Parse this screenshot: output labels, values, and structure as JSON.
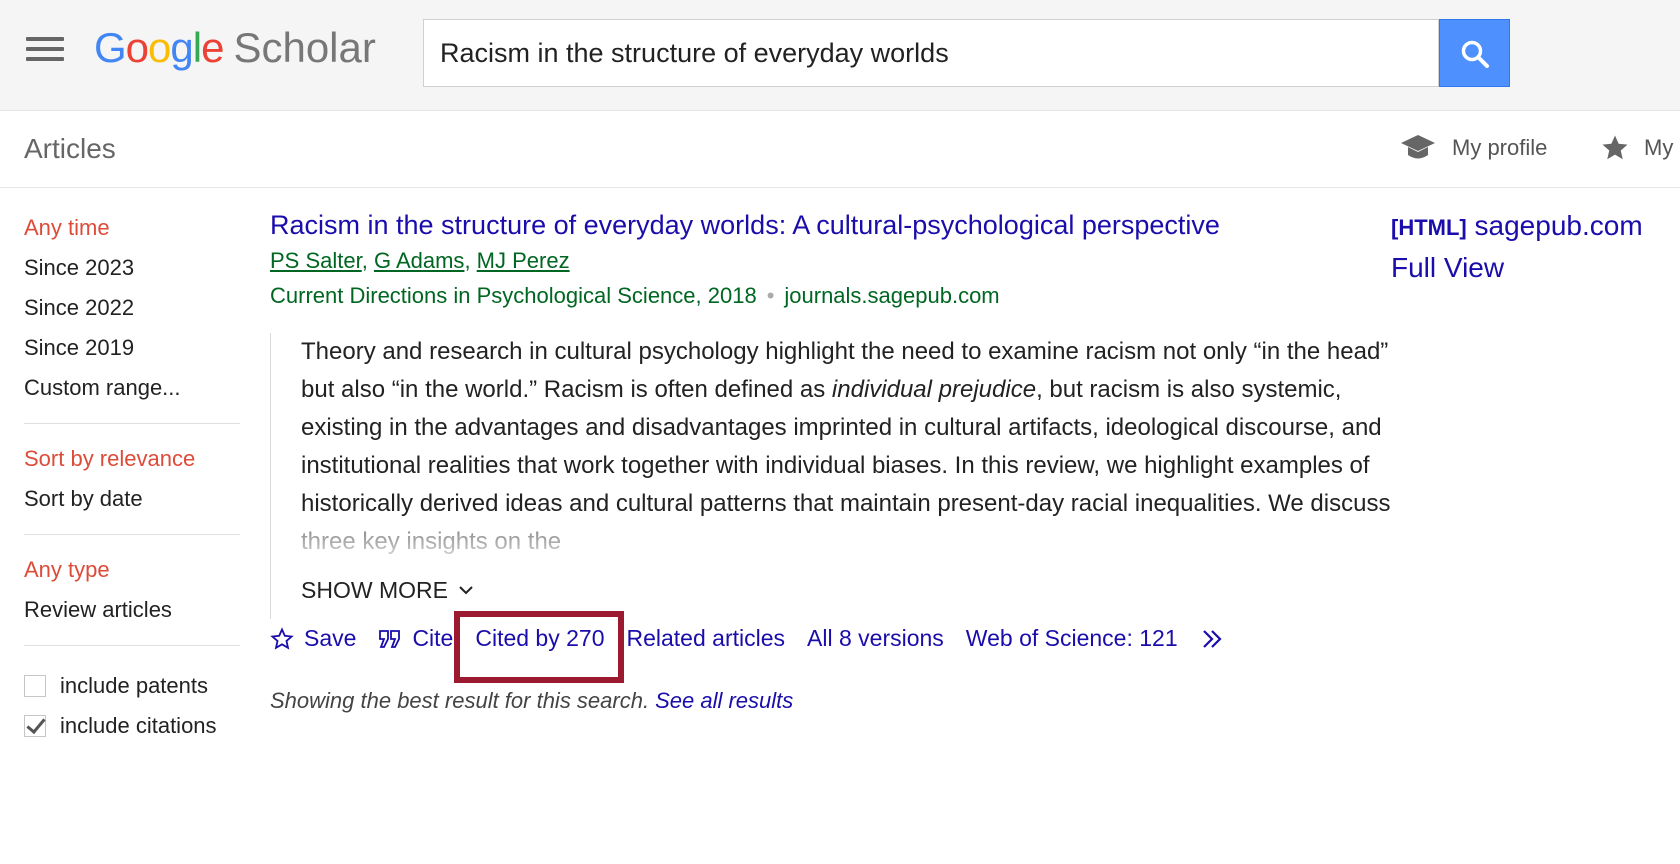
{
  "header": {
    "logo_scholar": "Scholar",
    "search_query": "Racism in the structure of everyday worlds"
  },
  "subbar": {
    "articles_label": "Articles",
    "my_profile": "My profile",
    "my_library": "My"
  },
  "sidebar": {
    "time_filters": [
      "Any time",
      "Since 2023",
      "Since 2022",
      "Since 2019",
      "Custom range..."
    ],
    "sort_options": [
      "Sort by relevance",
      "Sort by date"
    ],
    "type_filters": [
      "Any type",
      "Review articles"
    ],
    "include_patents": "include patents",
    "include_citations": "include citations"
  },
  "result": {
    "title": "Racism in the structure of everyday worlds: A cultural-psychological perspective",
    "authors": [
      "PS Salter",
      "G Adams",
      "MJ Perez"
    ],
    "venue": "Current Directions in Psychological Science, 2018",
    "domain": "journals.sagepub.com",
    "abstract_1": "Theory and research in cultural psychology highlight the need to examine racism not only “in the head” but also “in the world.” Racism is often defined as ",
    "abstract_em": "individual prejudice",
    "abstract_2": ", but racism is also systemic, existing in the advantages and disadvantages imprinted in cultural artifacts, ideological discourse, and institutional realities that work together with individual biases. In this review, we highlight examples of historically derived ideas and cultural patterns that maintain present-day racial inequalities. We discuss three key insights on the",
    "show_more": "SHOW MORE",
    "actions": {
      "save": "Save",
      "cite": "Cite",
      "cited_by": "Cited by 270",
      "related": "Related articles",
      "versions": "All 8 versions",
      "wos": "Web of Science: 121"
    },
    "footer_note": "Showing the best result for this search.",
    "see_all": "See all results"
  },
  "side_links": {
    "html_tag": "[HTML]",
    "site": "sagepub.com",
    "full_view": "Full View"
  },
  "colors": {
    "link": "#1a0dab",
    "green": "#006621",
    "active_filter": "#dd4b39",
    "search_button": "#4d90fe",
    "highlight": "#9c1a2f"
  }
}
